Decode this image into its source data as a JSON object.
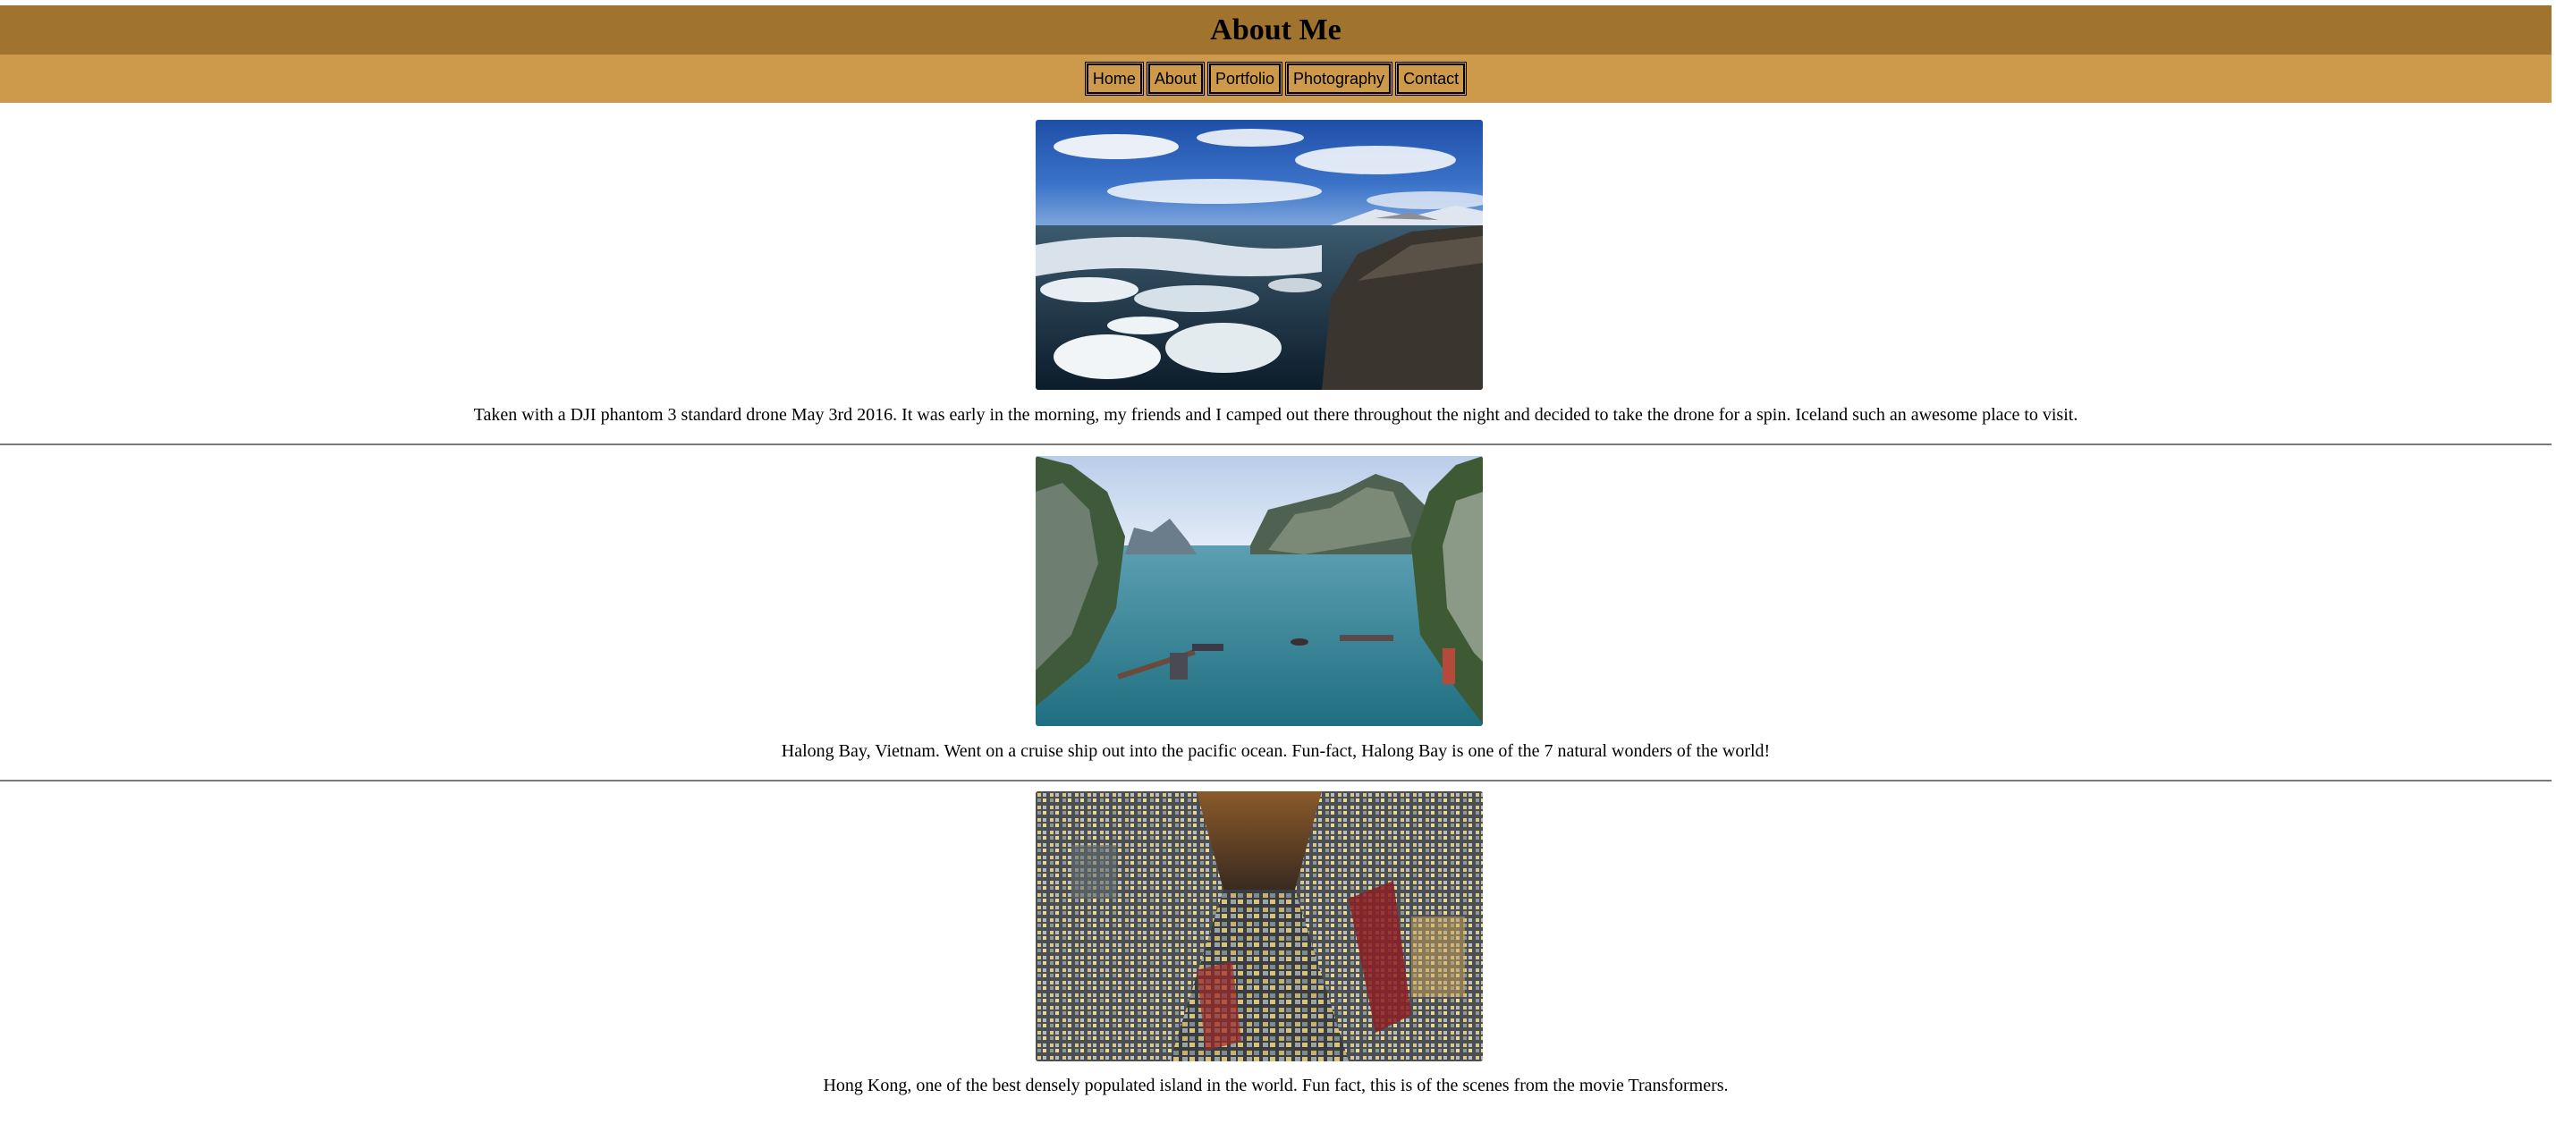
{
  "header": {
    "title": "About Me"
  },
  "nav": {
    "items": [
      "Home",
      "About",
      "Portfolio",
      "Photography",
      "Contact"
    ]
  },
  "photos": [
    {
      "caption": "Taken with a DJI phantom 3 standard drone May 3rd 2016. It was early in the morning, my friends and I camped out there throughout the night and decided to take the drone for a spin. Iceland such an awesome place to visit."
    },
    {
      "caption": "Halong Bay, Vietnam. Went on a cruise ship out into the pacific ocean. Fun-fact, Halong Bay is one of the 7 natural wonders of the world!"
    },
    {
      "caption": "Hong Kong, one of the best densely populated island in the world. Fun fact, this is of the scenes from the movie Transformers."
    }
  ],
  "colors": {
    "title_bar": "#a0742f",
    "nav_bar": "#cc9a4a"
  }
}
